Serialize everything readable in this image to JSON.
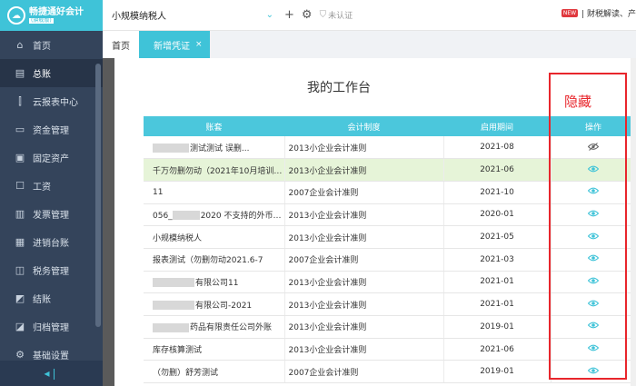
{
  "brand": {
    "name": "畅捷通好会计",
    "sub": "(旗舰版)"
  },
  "sidebar": {
    "items": [
      {
        "label": "首页",
        "icon": "home-icon",
        "glyph": "⌂"
      },
      {
        "label": "总账",
        "icon": "ledger-icon",
        "glyph": "▤",
        "active": true
      },
      {
        "label": "云报表中心",
        "icon": "chart-icon",
        "glyph": "⫿"
      },
      {
        "label": "资金管理",
        "icon": "wallet-icon",
        "glyph": "▭"
      },
      {
        "label": "固定资产",
        "icon": "asset-icon",
        "glyph": "▣"
      },
      {
        "label": "工资",
        "icon": "salary-icon",
        "glyph": "☐"
      },
      {
        "label": "发票管理",
        "icon": "invoice-icon",
        "glyph": "▥"
      },
      {
        "label": "进销台账",
        "icon": "inventory-icon",
        "glyph": "▦"
      },
      {
        "label": "税务管理",
        "icon": "tax-icon",
        "glyph": "◫"
      },
      {
        "label": "结账",
        "icon": "close-books-icon",
        "glyph": "◩"
      },
      {
        "label": "归档管理",
        "icon": "archive-icon",
        "glyph": "◪"
      },
      {
        "label": "基础设置",
        "icon": "settings-icon",
        "glyph": "⚙"
      }
    ],
    "collapse_glyph": "◂❘"
  },
  "topbar": {
    "company": "小规模纳税人",
    "cert": "未认证",
    "news_badge": "NEW",
    "news_text": "| 财税解读、产"
  },
  "tabs": [
    {
      "label": "首页",
      "active": false
    },
    {
      "label": "新增凭证",
      "active": true,
      "close": "×"
    }
  ],
  "workbench": {
    "title": "我的工作台",
    "hidden_label": "隐藏",
    "columns": [
      "账套",
      "会计制度",
      "启用期间",
      "操作"
    ],
    "rows": [
      {
        "name": "测试测试 误删...",
        "blur": [
          40,
          0
        ],
        "rule": "2013小企业会计准则",
        "date": "2021-08",
        "op": "eye-off-icon"
      },
      {
        "name": "千万勿删勿动（2021年10月培训）...",
        "rule": "2013小企业会计准则",
        "date": "2021-06",
        "op": "eye-icon",
        "highlight": true
      },
      {
        "name": "11",
        "rule": "2007企业会计准则",
        "date": "2021-10",
        "op": "eye-icon"
      },
      {
        "name_prefix": "056_",
        "name": "2020 不支持的外币核...",
        "blur": [
          30,
          1
        ],
        "rule": "2013小企业会计准则",
        "date": "2020-01",
        "op": "eye-icon"
      },
      {
        "name": "小规模纳税人",
        "rule": "2013小企业会计准则",
        "date": "2021-05",
        "op": "eye-icon"
      },
      {
        "name": "报表测试（勿删勿动2021.6-7",
        "rule": "2007企业会计准则",
        "date": "2021-03",
        "op": "eye-icon"
      },
      {
        "name": "有限公司11",
        "blur": [
          46,
          0
        ],
        "rule": "2013小企业会计准则",
        "date": "2021-01",
        "op": "eye-icon"
      },
      {
        "name": "有限公司-2021",
        "blur": [
          46,
          0
        ],
        "rule": "2013小企业会计准则",
        "date": "2021-01",
        "op": "eye-icon"
      },
      {
        "name": "药品有限责任公司外账",
        "blur": [
          40,
          0
        ],
        "rule": "2013小企业会计准则",
        "date": "2019-01",
        "op": "eye-icon"
      },
      {
        "name": "库存核算测试",
        "rule": "2013小企业会计准则",
        "date": "2021-06",
        "op": "eye-icon"
      },
      {
        "name": "（勿删）舒芳测试",
        "rule": "2007企业会计准则",
        "date": "2019-01",
        "op": "eye-icon"
      }
    ]
  },
  "colors": {
    "accent": "#3fc3d8",
    "sidebar": "#34445b",
    "highlight_box": "#e8262c",
    "row_highlight": "#e6f4d8"
  }
}
